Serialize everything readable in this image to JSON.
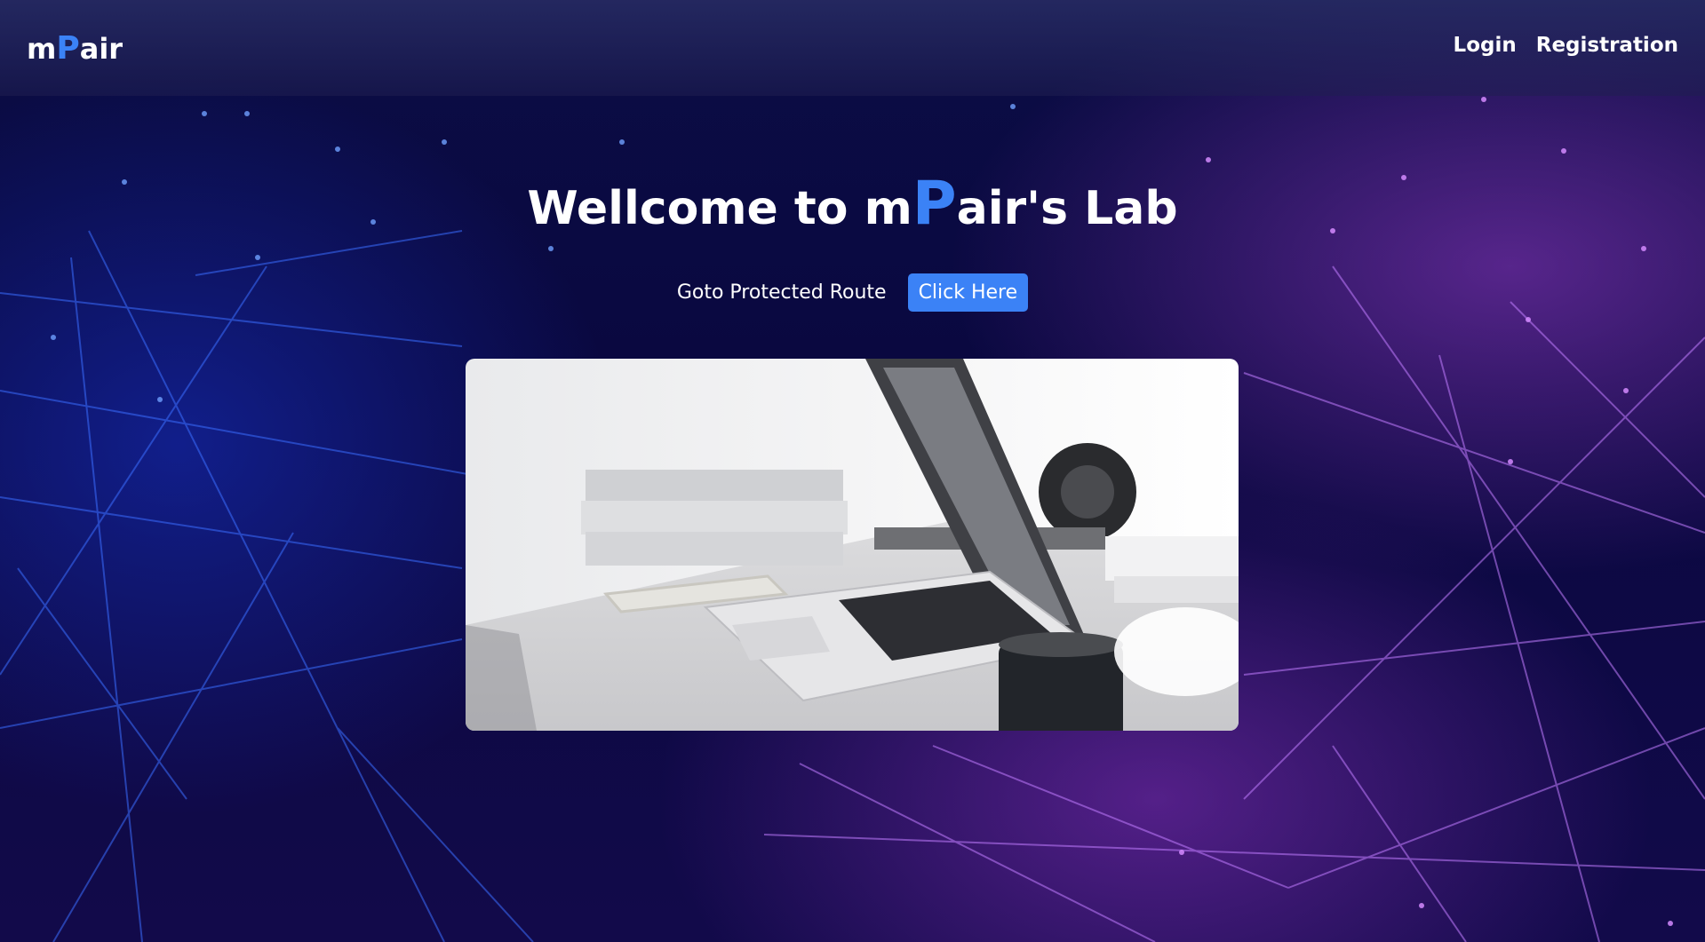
{
  "navbar": {
    "brand_prefix": "m",
    "brand_accent": "P",
    "brand_suffix": "air",
    "links": [
      {
        "label": "Login"
      },
      {
        "label": "Registration"
      }
    ]
  },
  "hero": {
    "title_prefix": "Wellcome to m",
    "title_accent": "P",
    "title_suffix": "air's Lab",
    "cta_label": "Goto Protected Route",
    "cta_button": "Click Here"
  },
  "colors": {
    "accent": "#3b82f6",
    "text": "#ffffff"
  }
}
